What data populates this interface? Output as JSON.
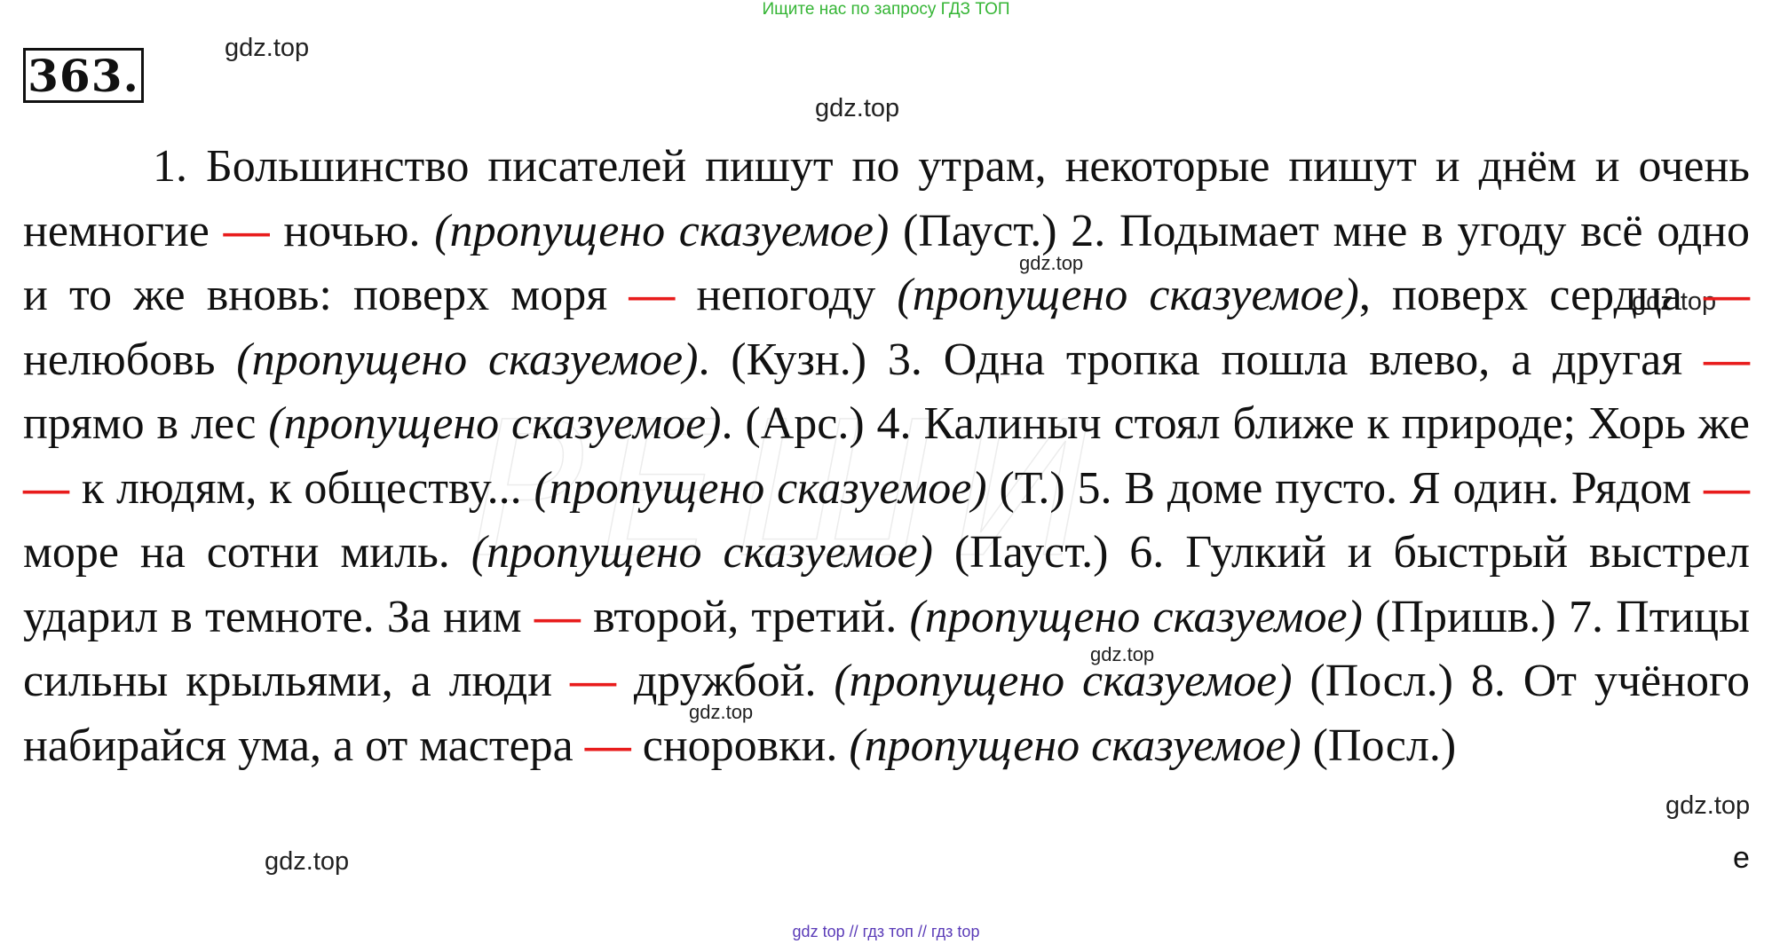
{
  "header": {
    "banner": "Ищите нас по запросу ГДЗ ТОП"
  },
  "task": {
    "number": "363."
  },
  "watermarks": {
    "label": "gdz.top"
  },
  "exercise": {
    "s1a": "1. Большинство писателей пишут по утрам, некоторые пишут и днём и очень немногие ",
    "s1b": " ночью. ",
    "n1": "(пропущено сказуемое)",
    "s2a": " (Пауст.) 2. Подымает мне в угоду всё одно и то же вновь: поверх моря ",
    "s2b": " непогоду ",
    "n2": "(пропущено сказуемое)",
    "s2c": ", поверх сердца ",
    "s2d": " нелюбовь ",
    "n3": "(пропущено сказуемое)",
    "s3a": ". (Кузн.) 3. Одна тропка пошла влево, а другая ",
    "s3b": " прямо в лес ",
    "n4": "(пропущено сказуемое)",
    "s4a": ". (Арс.) 4. Калиныч стоял ближе к природе; Хорь же ",
    "s4b": " к людям, к обществу... ",
    "n5": "(пропущено сказуемое)",
    "s5a": " (Т.) 5. В доме пусто. Я один. Рядом ",
    "s5b": " море на сотни миль. ",
    "n6": "(пропущено сказуемое)",
    "s6a": " (Пауст.) 6. Гулкий и быстрый выстрел ударил в темноте. За ним ",
    "s6b": " второй, третий. ",
    "n7": "(пропущено сказуемое)",
    "s7a": " (Пришв.) 7. Птицы сильны крыльями, а люди ",
    "s7b": " дружбой. ",
    "n8": "(пропущено сказуемое)",
    "s8a": " (Посл.) 8. От учёного набирайся ума, а от мастера ",
    "s8b": " сноровки. ",
    "n9": "(пропущено сказуемое)",
    "s8c": " (Посл.)",
    "dash": "—"
  },
  "corner": {
    "letter": "e"
  },
  "footer": {
    "text": "gdz top  //  гдз топ  //  гдз top"
  },
  "colors": {
    "dash": "#e81c1c",
    "banner": "#35b535",
    "footer": "#5a3bb8"
  }
}
